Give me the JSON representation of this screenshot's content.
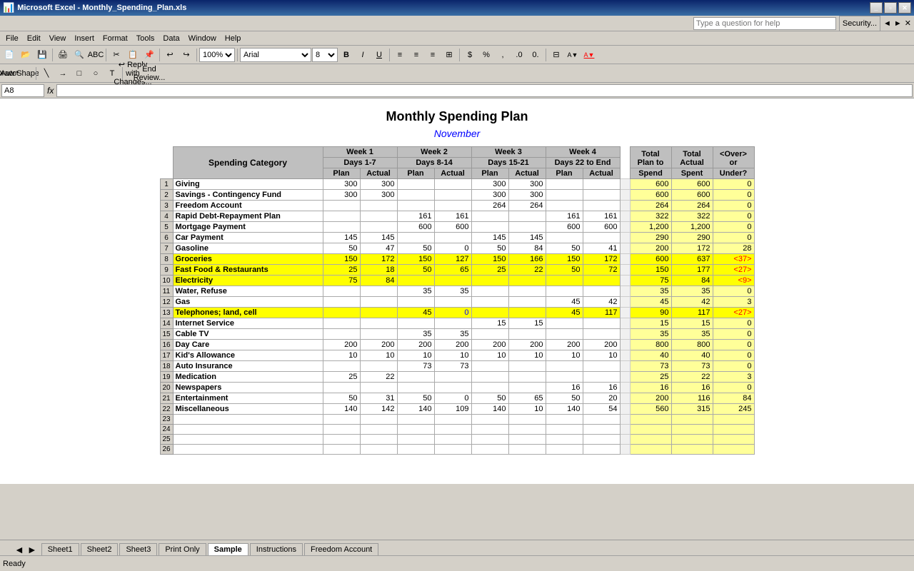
{
  "titleBar": {
    "title": "Microsoft Excel - Monthly_Spending_Plan.xls",
    "icon": "📊"
  },
  "menuBar": {
    "items": [
      "File",
      "Edit",
      "View",
      "Insert",
      "Format",
      "Tools",
      "Data",
      "Window",
      "Help"
    ]
  },
  "askBar": {
    "placeholder": "Type a question for help",
    "buttonLabel": "Security..."
  },
  "formulaBar": {
    "cellRef": "A8",
    "value": ""
  },
  "spreadsheet": {
    "title": "Monthly Spending Plan",
    "subtitle": "November",
    "headers": {
      "spendingCategory": "Spending Category",
      "week1": "Week 1",
      "week1Days": "Days 1-7",
      "week2": "Week 2",
      "week2Days": "Days 8-14",
      "week3": "Week 3",
      "week3Days": "Days 15-21",
      "week4": "Week 4",
      "week4Days": "Days 22 to End",
      "totalPlanLabel": "Total",
      "totalPlanToSpend": "Plan to",
      "totalPlanSpend": "Spend",
      "totalActualLabel": "Total",
      "totalActualSpent": "Actual",
      "totalActualSpent2": "Spent",
      "overOrUnder": "<Over>",
      "orLabel": "or",
      "underLabel": "Under?",
      "plan": "Plan",
      "actual": "Actual"
    },
    "rows": [
      {
        "num": "1",
        "category": "Giving",
        "w1plan": "300",
        "w1actual": "300",
        "w2plan": "",
        "w2actual": "",
        "w3plan": "300",
        "w3actual": "300",
        "w4plan": "",
        "w4actual": "",
        "totalPlan": "600",
        "totalActual": "600",
        "overUnder": "0",
        "style": "white"
      },
      {
        "num": "2",
        "category": "Savings - Contingency Fund",
        "w1plan": "300",
        "w1actual": "300",
        "w2plan": "",
        "w2actual": "",
        "w3plan": "300",
        "w3actual": "300",
        "w4plan": "",
        "w4actual": "",
        "totalPlan": "600",
        "totalActual": "600",
        "overUnder": "0",
        "style": "white"
      },
      {
        "num": "3",
        "category": "Freedom Account",
        "w1plan": "",
        "w1actual": "",
        "w2plan": "",
        "w2actual": "",
        "w3plan": "264",
        "w3actual": "264",
        "w4plan": "",
        "w4actual": "",
        "totalPlan": "264",
        "totalActual": "264",
        "overUnder": "0",
        "style": "white"
      },
      {
        "num": "4",
        "category": "Rapid Debt-Repayment Plan",
        "w1plan": "",
        "w1actual": "",
        "w2plan": "161",
        "w2actual": "161",
        "w3plan": "",
        "w3actual": "",
        "w4plan": "161",
        "w4actual": "161",
        "totalPlan": "322",
        "totalActual": "322",
        "overUnder": "0",
        "style": "white"
      },
      {
        "num": "5",
        "category": "Mortgage Payment",
        "w1plan": "",
        "w1actual": "",
        "w2plan": "600",
        "w2actual": "600",
        "w3plan": "",
        "w3actual": "",
        "w4plan": "600",
        "w4actual": "600",
        "totalPlan": "1,200",
        "totalActual": "1,200",
        "overUnder": "0",
        "style": "white"
      },
      {
        "num": "6",
        "category": "Car Payment",
        "w1plan": "145",
        "w1actual": "145",
        "w2plan": "",
        "w2actual": "",
        "w3plan": "145",
        "w3actual": "145",
        "w4plan": "",
        "w4actual": "",
        "totalPlan": "290",
        "totalActual": "290",
        "overUnder": "0",
        "style": "white"
      },
      {
        "num": "7",
        "category": "Gasoline",
        "w1plan": "50",
        "w1actual": "47",
        "w2plan": "50",
        "w2actual": "0",
        "w3plan": "50",
        "w3actual": "84",
        "w4plan": "50",
        "w4actual": "41",
        "totalPlan": "200",
        "totalActual": "172",
        "overUnder": "28",
        "style": "white"
      },
      {
        "num": "8",
        "category": "Groceries",
        "w1plan": "150",
        "w1actual": "172",
        "w2plan": "150",
        "w2actual": "127",
        "w3plan": "150",
        "w3actual": "166",
        "w4plan": "150",
        "w4actual": "172",
        "totalPlan": "600",
        "totalActual": "637",
        "overUnder": "<37>",
        "style": "yellow"
      },
      {
        "num": "9",
        "category": "Fast Food & Restaurants",
        "w1plan": "25",
        "w1actual": "18",
        "w2plan": "50",
        "w2actual": "65",
        "w3plan": "25",
        "w3actual": "22",
        "w4plan": "50",
        "w4actual": "72",
        "totalPlan": "150",
        "totalActual": "177",
        "overUnder": "<27>",
        "style": "yellow"
      },
      {
        "num": "10",
        "category": "Electricity",
        "w1plan": "75",
        "w1actual": "84",
        "w2plan": "",
        "w2actual": "",
        "w3plan": "",
        "w3actual": "",
        "w4plan": "",
        "w4actual": "",
        "totalPlan": "75",
        "totalActual": "84",
        "overUnder": "<9>",
        "style": "yellow"
      },
      {
        "num": "11",
        "category": "Water, Refuse",
        "w1plan": "",
        "w1actual": "",
        "w2plan": "35",
        "w2actual": "35",
        "w3plan": "",
        "w3actual": "",
        "w4plan": "",
        "w4actual": "",
        "totalPlan": "35",
        "totalActual": "35",
        "overUnder": "0",
        "style": "white"
      },
      {
        "num": "12",
        "category": "Gas",
        "w1plan": "",
        "w1actual": "",
        "w2plan": "",
        "w2actual": "",
        "w3plan": "",
        "w3actual": "",
        "w4plan": "45",
        "w4actual": "42",
        "totalPlan": "45",
        "totalActual": "42",
        "overUnder": "3",
        "style": "white"
      },
      {
        "num": "13",
        "category": "Telephones; land, cell",
        "w1plan": "",
        "w1actual": "",
        "w2plan": "45",
        "w2actual": "0",
        "w3plan": "",
        "w3actual": "",
        "w4plan": "45",
        "w4actual": "117",
        "totalPlan": "90",
        "totalActual": "117",
        "overUnder": "<27>",
        "style": "yellow"
      },
      {
        "num": "14",
        "category": "Internet Service",
        "w1plan": "",
        "w1actual": "",
        "w2plan": "",
        "w2actual": "",
        "w3plan": "15",
        "w3actual": "15",
        "w4plan": "",
        "w4actual": "",
        "totalPlan": "15",
        "totalActual": "15",
        "overUnder": "0",
        "style": "white"
      },
      {
        "num": "15",
        "category": "Cable TV",
        "w1plan": "",
        "w1actual": "",
        "w2plan": "35",
        "w2actual": "35",
        "w3plan": "",
        "w3actual": "",
        "w4plan": "",
        "w4actual": "",
        "totalPlan": "35",
        "totalActual": "35",
        "overUnder": "0",
        "style": "white"
      },
      {
        "num": "16",
        "category": "Day Care",
        "w1plan": "200",
        "w1actual": "200",
        "w2plan": "200",
        "w2actual": "200",
        "w3plan": "200",
        "w3actual": "200",
        "w4plan": "200",
        "w4actual": "200",
        "totalPlan": "800",
        "totalActual": "800",
        "overUnder": "0",
        "style": "white"
      },
      {
        "num": "17",
        "category": "Kid's Allowance",
        "w1plan": "10",
        "w1actual": "10",
        "w2plan": "10",
        "w2actual": "10",
        "w3plan": "10",
        "w3actual": "10",
        "w4plan": "10",
        "w4actual": "10",
        "totalPlan": "40",
        "totalActual": "40",
        "overUnder": "0",
        "style": "white"
      },
      {
        "num": "18",
        "category": "Auto Insurance",
        "w1plan": "",
        "w1actual": "",
        "w2plan": "73",
        "w2actual": "73",
        "w3plan": "",
        "w3actual": "",
        "w4plan": "",
        "w4actual": "",
        "totalPlan": "73",
        "totalActual": "73",
        "overUnder": "0",
        "style": "white"
      },
      {
        "num": "19",
        "category": "Medication",
        "w1plan": "25",
        "w1actual": "22",
        "w2plan": "",
        "w2actual": "",
        "w3plan": "",
        "w3actual": "",
        "w4plan": "",
        "w4actual": "",
        "totalPlan": "25",
        "totalActual": "22",
        "overUnder": "3",
        "style": "white"
      },
      {
        "num": "20",
        "category": "Newspapers",
        "w1plan": "",
        "w1actual": "",
        "w2plan": "",
        "w2actual": "",
        "w3plan": "",
        "w3actual": "",
        "w4plan": "16",
        "w4actual": "16",
        "totalPlan": "16",
        "totalActual": "16",
        "overUnder": "0",
        "style": "white"
      },
      {
        "num": "21",
        "category": "Entertainment",
        "w1plan": "50",
        "w1actual": "31",
        "w2plan": "50",
        "w2actual": "0",
        "w3plan": "50",
        "w3actual": "65",
        "w4plan": "50",
        "w4actual": "20",
        "totalPlan": "200",
        "totalActual": "116",
        "overUnder": "84",
        "style": "white"
      },
      {
        "num": "22",
        "category": "Miscellaneous",
        "w1plan": "140",
        "w1actual": "142",
        "w2plan": "140",
        "w2actual": "109",
        "w3plan": "140",
        "w3actual": "10",
        "w4plan": "140",
        "w4actual": "54",
        "totalPlan": "560",
        "totalActual": "315",
        "overUnder": "245",
        "style": "white"
      },
      {
        "num": "23",
        "category": "",
        "w1plan": "",
        "w1actual": "",
        "w2plan": "",
        "w2actual": "",
        "w3plan": "",
        "w3actual": "",
        "w4plan": "",
        "w4actual": "",
        "totalPlan": "",
        "totalActual": "",
        "overUnder": "",
        "style": "white"
      },
      {
        "num": "24",
        "category": "",
        "w1plan": "",
        "w1actual": "",
        "w2plan": "",
        "w2actual": "",
        "w3plan": "",
        "w3actual": "",
        "w4plan": "",
        "w4actual": "",
        "totalPlan": "",
        "totalActual": "",
        "overUnder": "",
        "style": "white"
      },
      {
        "num": "25",
        "category": "",
        "w1plan": "",
        "w1actual": "",
        "w2plan": "",
        "w2actual": "",
        "w3plan": "",
        "w3actual": "",
        "w4plan": "",
        "w4actual": "",
        "totalPlan": "",
        "totalActual": "",
        "overUnder": "",
        "style": "white"
      },
      {
        "num": "26",
        "category": "",
        "w1plan": "",
        "w1actual": "",
        "w2plan": "",
        "w2actual": "",
        "w3plan": "",
        "w3actual": "",
        "w4plan": "",
        "w4actual": "",
        "totalPlan": "",
        "totalActual": "",
        "overUnder": "",
        "style": "white"
      }
    ]
  },
  "tabs": {
    "sheets": [
      "Sheet1",
      "Sheet2",
      "Sheet3",
      "Print Only",
      "Sample",
      "Instructions",
      "Freedom Account"
    ],
    "active": "Sample"
  },
  "statusBar": {
    "text": "Ready"
  }
}
